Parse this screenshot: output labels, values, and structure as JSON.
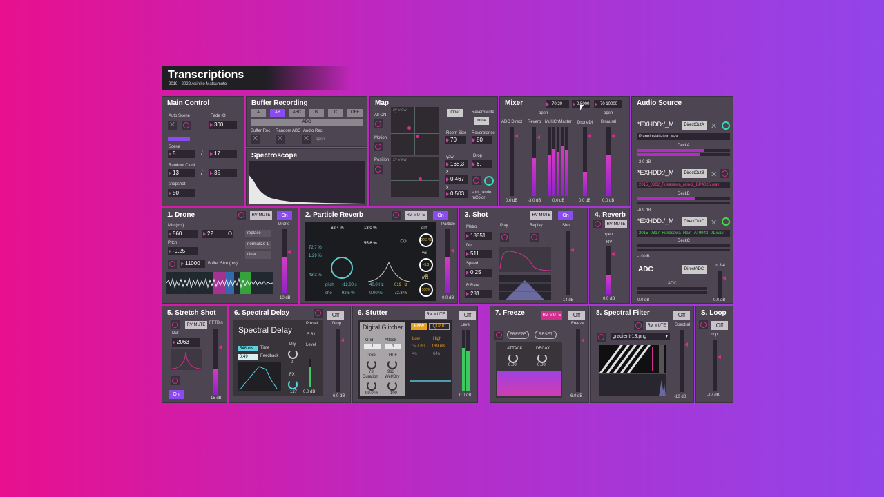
{
  "header": {
    "title": "Transcriptions",
    "subtitle": "2019 - 2022 Akihiko Matsumoto"
  },
  "main_control": {
    "title": "Main Control",
    "auto_scene_label": "Auto Scene",
    "fade_io_label": "Fade IO",
    "fade_io_value": "300",
    "scene_label": "Scene",
    "scene_value": "5",
    "scene_total": "17",
    "random_clock_label": "Random Clock",
    "random_clock_value": "13",
    "random_clock_total": "35",
    "snapshot_label": "snapshot",
    "snapshot_value": "50",
    "slash": "/"
  },
  "buffer_recording": {
    "title": "Buffer Recording",
    "buttons": [
      "A",
      "AB",
      "ABC",
      "B",
      "C",
      "OFF"
    ],
    "active": "AB",
    "adc_label": "ADC",
    "buffer_rec_label": "Buffer Rec",
    "random_abc_label": "Random ABC",
    "audio_rec_label": "Audio Rec",
    "open_label": "open"
  },
  "spectroscope": {
    "title": "Spectroscope"
  },
  "map": {
    "title": "Map",
    "all_on_label": "All ON",
    "motion_label": "Motion",
    "position_label": "Position",
    "open_button": "Oper",
    "reverb_mute_label": "ReverbMute",
    "mute_button": "mute",
    "room_size_label": "Room Size",
    "room_size_value": "70",
    "reverb_balance_label": "Reverblance",
    "reverb_balance_value": "80",
    "yaw_label": "yaw",
    "yaw_value": "168.3",
    "x_label": "x",
    "x_value": "0.467",
    "y_label": "y",
    "y_value": "0.503",
    "drop_label": "Drop",
    "drop_value": "6.",
    "sub_random_label": "sub_rando mColor",
    "xy_view_label": "xy view",
    "zy_view_label": "zy view"
  },
  "mixer": {
    "title": "Mixer",
    "readout_a": "-70 20",
    "readout_b": "0.5000",
    "readout_c": "-70 10000",
    "open_a": "open",
    "open_b": "open",
    "channels": [
      "ADC Direct",
      "Reverb",
      "MultiChMaster",
      "DroneDl",
      "Binaural"
    ],
    "db_values": [
      "0.0 dB",
      "-3.0 dB",
      "0.0 dB",
      "0.0 dB",
      "0.0 dB"
    ]
  },
  "audio_source": {
    "title": "Audio Source",
    "path_a": "*EXHDD:/_M",
    "direct_a": "DirectOutA",
    "file_a": "PianoInstallation.wav",
    "deck_a": "DeckA",
    "db_a": "-2.0 dB",
    "path_b": "*EXHDD:/_M",
    "direct_b": "DirectOutB",
    "file_b": "2015_0802_Fukasawa_rain-2_BP4025.wav",
    "deck_b": "DeckB",
    "db_b": "-6.9 dB",
    "path_c": "*EXHDD:/_M",
    "direct_c": "DirectOutC",
    "file_c": "2015_0817_Fukasawa_Rain_AT9943_01.wav",
    "deck_c": "DeckC",
    "db_c": "-10 dB",
    "adc_title": "ADC",
    "direct_adc": "DirectADC",
    "adc_label": "ADC",
    "in_label": "in 3-4",
    "db_adc": "0.0 dB",
    "db_in": "0.0 dB"
  },
  "drone": {
    "title": "1. Drone",
    "rv_mute": "RV MUTE",
    "on": "On",
    "min_label": "Min (ms)",
    "min_value": "560",
    "max_value": "22",
    "pitch_label": "Pitch",
    "pitch_value": "-0.25",
    "buffer_value": "11000",
    "buffer_label": "Buffer Size (ms)",
    "replace": "replace",
    "normalize": "normalize 1.",
    "clear": "clear",
    "drone_label": "Drone",
    "db": "-10 dB"
  },
  "particle_reverb": {
    "title": "2. Particle Reverb",
    "rv_mute": "RV MUTE",
    "on": "On",
    "v1": "62.4 %",
    "v2": "13.0 %",
    "v3": "55.6 %",
    "v4": "72.7 %",
    "v5": "1.29 %",
    "v6": "43.3 %",
    "pitch_label": "pitch",
    "pitch_value": "-12.00 s",
    "cho_label": "cho",
    "cho_value": "92.5 %",
    "hz1": "40.0 Hz",
    "pct1": "0.00 %",
    "hz2": "619 Hz",
    "pct2": "72.3 %",
    "diff_label": "diff",
    "diff_value": "22.2 %",
    "vol_label": "vol",
    "vol_value": "-3.3 dB",
    "mix_label": "mix",
    "mix_value": "100%",
    "particle_label": "Particle",
    "db": "0.0 dB"
  },
  "shot": {
    "title": "3. Shot",
    "rv_mute": "RV MUTE",
    "on": "On",
    "metro_label": "Metro",
    "metro_value": "18851",
    "dur_label": "Dur",
    "dur_value": "511",
    "speed_label": "Speed",
    "speed_value": "0.25",
    "rrate_label": "R.Rate",
    "rrate_value": "281",
    "play_label": "Play",
    "replay_label": "Replay",
    "shot_label": "Shot",
    "db": "-14 dB"
  },
  "reverb": {
    "title": "4. Reverb",
    "rv_mute": "RV MUTE",
    "open": "open",
    "rv_label": "RV",
    "db": "0.0 dB"
  },
  "stretch_shot": {
    "title": "5. Stretch Shot",
    "rv_mute": "RV MUTE",
    "fft_label": "FFTBin",
    "dur_label": "Dur",
    "dur_value": "2063",
    "on": "On",
    "db": "-15 dB"
  },
  "spectral_delay": {
    "title": "6. Spectral Delay",
    "off": "Off",
    "device": "Spectral Delay",
    "preset_label": "Preset",
    "preset_value": "5.81",
    "time_value": "548 ms",
    "time_label": "Time",
    "feedback_value": "0.49",
    "feedback_label": "Feedback",
    "dry_label": "Dry",
    "dry_value": "0",
    "level_label": "Level",
    "fx_label": "FX",
    "fx_value": "127",
    "level_db": "0.0 dB",
    "drop_label": "Drop",
    "db": "-6.0 dB"
  },
  "stutter": {
    "title": "6. Stutter",
    "rv_mute": "RV MUTE",
    "off": "Off",
    "device": "Digital Glitcher",
    "grid_label": "Grid",
    "grid_value": "1",
    "attack_label": "Attack",
    "attack_value": "1",
    "prob_label": "Prob",
    "prob_value": "73",
    "hpf_label": "HPF",
    "hpf_value": "913 H",
    "duration_label": "Duration",
    "duration_value": "99.0 %",
    "wetdry_label": "Wet/Dry",
    "wetdry_value": "100",
    "free": "Free",
    "quant": "Quant",
    "low_label": "Low",
    "low_value": "15.7 ms",
    "high_label": "High",
    "high_value": "139 ms",
    "low_div": "4n",
    "high_div": "64n",
    "level_label": "Level",
    "db": "0.0 dB"
  },
  "freeze": {
    "title": "7. Freeze",
    "rv_mute": "RV MUTE",
    "off": "Off",
    "freeze_btn": "FREEZE",
    "reset_btn": "RESET",
    "attack_label": "ATTACK",
    "attack_value": "0.00",
    "decay_label": "DECAY",
    "decay_value": "0.00",
    "freeze_label": "Freeze",
    "db": "-6.0 dB"
  },
  "spectral_filter": {
    "title": "8. Spectral Filter",
    "rv_mute": "RV MUTE",
    "off": "Off",
    "file": "gradient-13.png",
    "spectral_label": "Spectral",
    "db": "-10 dB"
  },
  "loop": {
    "title": "S. Loop",
    "off": "Off",
    "loop_label": "Loop",
    "db": "-17 dB"
  }
}
